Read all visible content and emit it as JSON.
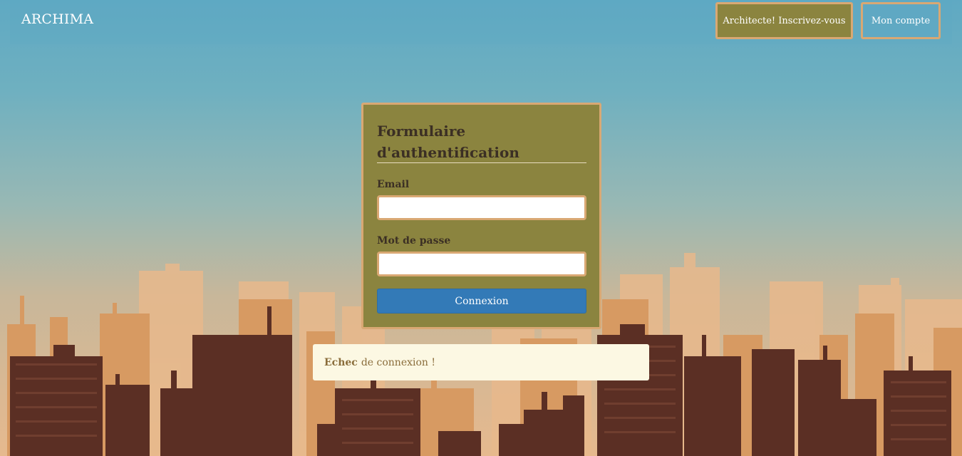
{
  "navbar": {
    "brand": "ARCHIMA",
    "signup_label": "Architecte! Inscrivez-vous",
    "account_label": "Mon compte"
  },
  "login": {
    "title": "Formulaire d'authentification",
    "email_label": "Email",
    "email_value": "",
    "password_label": "Mot de passe",
    "password_value": "",
    "submit_label": "Connexion"
  },
  "alert": {
    "strong": "Echec",
    "message": "de connexion !"
  },
  "colors": {
    "card_bg": "#8b843f",
    "card_border": "#d9a873",
    "button_primary": "#337ab7",
    "alert_bg": "#fcf8e3",
    "alert_text": "#8a6d3b"
  }
}
